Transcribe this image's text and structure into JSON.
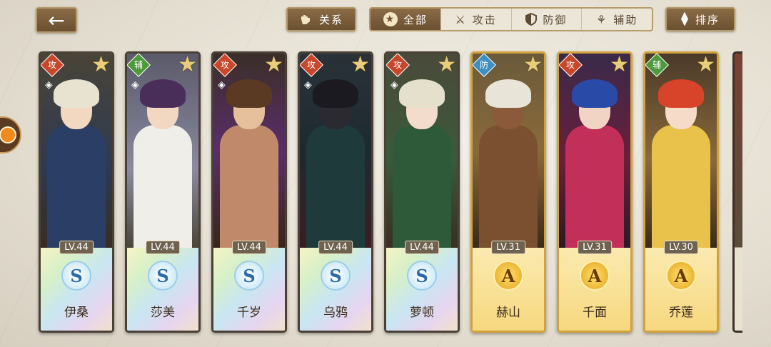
{
  "toolbar": {
    "back_label": "←",
    "relation_label": "关系",
    "sort_label": "排序",
    "filters": [
      {
        "label": "全部",
        "icon": "star-badge-icon"
      },
      {
        "label": "攻击",
        "icon": "crossed-swords-icon"
      },
      {
        "label": "防御",
        "icon": "shield-icon"
      },
      {
        "label": "辅助",
        "icon": "support-icon"
      }
    ]
  },
  "heroes": [
    {
      "type": "攻",
      "rank": "S",
      "level": "LV.44",
      "name": "伊桑"
    },
    {
      "type": "辅",
      "rank": "S",
      "level": "LV.44",
      "name": "莎美"
    },
    {
      "type": "攻",
      "rank": "S",
      "level": "LV.44",
      "name": "千岁"
    },
    {
      "type": "攻",
      "rank": "S",
      "level": "LV.44",
      "name": "乌鸦"
    },
    {
      "type": "攻",
      "rank": "S",
      "level": "LV.44",
      "name": "萝顿"
    },
    {
      "type": "防",
      "rank": "A",
      "level": "LV.31",
      "name": "赫山"
    },
    {
      "type": "攻",
      "rank": "A",
      "level": "LV.31",
      "name": "千面"
    },
    {
      "type": "辅",
      "rank": "A",
      "level": "LV.30",
      "name": "乔莲"
    }
  ],
  "colors": {
    "button_brown": "#7a5c3a",
    "attack_badge": "#c8472a",
    "support_badge": "#4e9a3b",
    "defense_badge": "#3b8fc4",
    "rank_a_gold": "#e4a21c"
  }
}
